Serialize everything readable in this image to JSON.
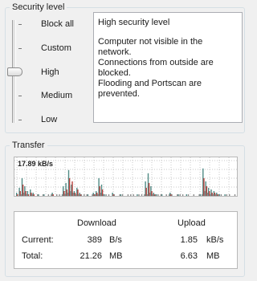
{
  "security": {
    "title": "Security level",
    "levels": [
      "Block all",
      "Custom",
      "High",
      "Medium",
      "Low"
    ],
    "selected_level": "High",
    "description": {
      "title": "High security level",
      "lines": [
        "Computer not visible in the network.",
        "Connections from outside are blocked.",
        "Flooding and Portscan are prevented."
      ]
    }
  },
  "transfer": {
    "title": "Transfer",
    "peak_label": "17.89 kB/s",
    "headers": {
      "download": "Download",
      "upload": "Upload"
    },
    "current": {
      "label": "Current:",
      "download_value": "389",
      "download_unit": "B/s",
      "upload_value": "1.85",
      "upload_unit": "kB/s"
    },
    "total": {
      "label": "Total:",
      "download_value": "21.26",
      "download_unit": "MB",
      "upload_value": "6.63",
      "upload_unit": "MB"
    }
  },
  "colors": {
    "download": "#4f8a85",
    "upload": "#b8413d",
    "gray": "#8a8a8a"
  },
  "chart_data": {
    "type": "bar",
    "ymax": 17.89,
    "ylabel": "kB/s",
    "series": [
      {
        "values": [
          2,
          5,
          11,
          6,
          3,
          4,
          2,
          0,
          1,
          0,
          1,
          0,
          0,
          2,
          0,
          0,
          0,
          6,
          8,
          16,
          7,
          3,
          5,
          2,
          0,
          0,
          1,
          0,
          2,
          3,
          11,
          7,
          1,
          0,
          0,
          2,
          0,
          0,
          1,
          0,
          0,
          0,
          0,
          0,
          1,
          0,
          0,
          9,
          14,
          6,
          2,
          1,
          0,
          1,
          0,
          0,
          2,
          0,
          0,
          1,
          0,
          0,
          1,
          0,
          0,
          0,
          0,
          1,
          17,
          9,
          5,
          4,
          3,
          2,
          1,
          0,
          1,
          0,
          0,
          0
        ]
      },
      {
        "values": [
          1,
          3,
          7,
          3,
          1,
          2,
          1,
          0,
          0,
          0,
          0,
          0,
          0,
          1,
          0,
          0,
          0,
          3,
          4,
          11,
          9,
          2,
          4,
          1,
          0,
          0,
          0,
          0,
          1,
          2,
          6,
          4,
          0,
          0,
          0,
          1,
          0,
          0,
          0,
          0,
          0,
          0,
          0,
          0,
          0,
          0,
          0,
          5,
          8,
          3,
          1,
          0,
          0,
          0,
          0,
          0,
          1,
          0,
          0,
          0,
          0,
          0,
          0,
          0,
          0,
          0,
          0,
          0,
          11,
          6,
          3,
          2,
          2,
          1,
          0,
          0,
          0,
          0,
          0,
          0
        ]
      },
      {
        "values": [
          0,
          1,
          2,
          1,
          0,
          1,
          0,
          1,
          0,
          1,
          0,
          1,
          1,
          0,
          1,
          1,
          1,
          1,
          2,
          3,
          2,
          1,
          1,
          1,
          1,
          1,
          0,
          1,
          1,
          1,
          2,
          1,
          1,
          1,
          0,
          1,
          0,
          1,
          1,
          0,
          1,
          1,
          1,
          0,
          1,
          1,
          1,
          1,
          2,
          1,
          1,
          1,
          1,
          0,
          1,
          1,
          1,
          0,
          1,
          1,
          1,
          0,
          1,
          0,
          1,
          0,
          1,
          1,
          3,
          2,
          1,
          1,
          1,
          1,
          1,
          0,
          1,
          1,
          0,
          1
        ]
      }
    ]
  }
}
